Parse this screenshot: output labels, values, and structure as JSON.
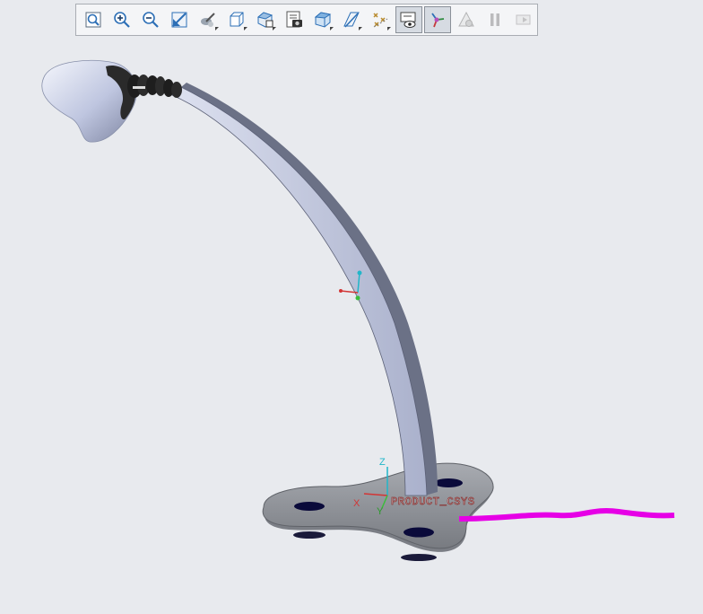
{
  "toolbar": {
    "buttons": [
      {
        "name": "refit-icon",
        "state": "normal"
      },
      {
        "name": "zoom-in-icon",
        "state": "normal"
      },
      {
        "name": "zoom-out-icon",
        "state": "normal"
      },
      {
        "name": "repaint-icon",
        "state": "normal"
      },
      {
        "name": "perspective-view-icon",
        "state": "normal",
        "flyout": true
      },
      {
        "name": "saved-orientations-icon",
        "state": "normal",
        "flyout": true
      },
      {
        "name": "named-views-icon",
        "state": "normal",
        "flyout": true
      },
      {
        "name": "view-manager-icon",
        "state": "normal"
      },
      {
        "name": "display-style-icon",
        "state": "normal",
        "flyout": true
      },
      {
        "name": "section-view-icon",
        "state": "normal",
        "flyout": true
      },
      {
        "name": "datum-display-icon",
        "state": "normal",
        "flyout": true
      },
      {
        "name": "annotation-display-icon",
        "state": "active"
      },
      {
        "name": "spin-center-icon",
        "state": "active"
      },
      {
        "name": "simulation-icon",
        "state": "disabled"
      },
      {
        "name": "pause-icon",
        "state": "disabled"
      },
      {
        "name": "skip-icon",
        "state": "disabled"
      }
    ]
  },
  "model": {
    "csys_label": "PRODUCT_CSYS",
    "axis_z": "Z",
    "axis_x": "X",
    "axis_y": "Y"
  },
  "colors": {
    "background": "#e8eaee",
    "cable": "#e600e6",
    "lamp_body": "#c7cde6",
    "base": "#8a8d93"
  }
}
